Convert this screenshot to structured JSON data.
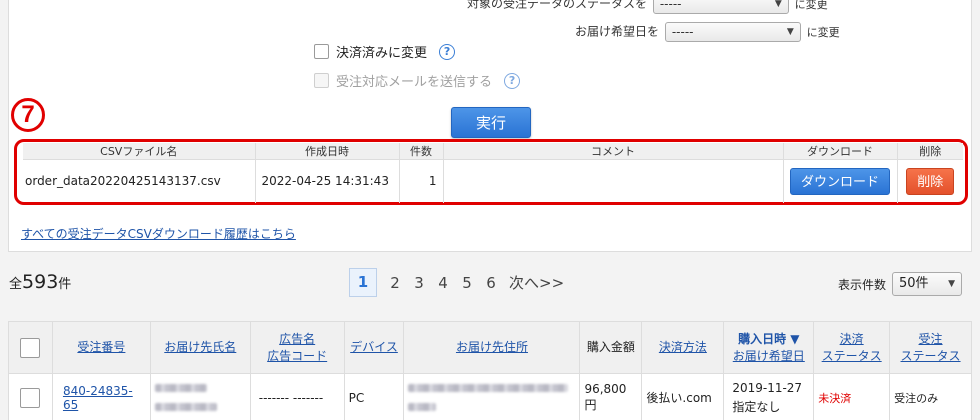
{
  "form": {
    "status_label": "対象の受注データのステータスを",
    "status_value": "-----",
    "status_suffix": "に変更",
    "date_label": "お届け希望日を",
    "date_value": "-----",
    "date_suffix": "に変更",
    "settled_label": "決済済みに変更",
    "mail_label": "受注対応メールを送信する",
    "help_glyph": "?",
    "step_number": "7",
    "execute_label": "実行"
  },
  "csv_table": {
    "headers": [
      "CSVファイル名",
      "作成日時",
      "件数",
      "コメント",
      "ダウンロード",
      "削除"
    ],
    "row": {
      "filename": "order_data20220425143137.csv",
      "created": "2022-04-25 14:31:43",
      "count": "1",
      "comment": "",
      "download_label": "ダウンロード",
      "delete_label": "削除"
    }
  },
  "history_link": "すべての受注データCSVダウンロード履歴はこちら",
  "summary": {
    "prefix": "全",
    "count": "593",
    "suffix": "件"
  },
  "pagination": {
    "pages": [
      "1",
      "2",
      "3",
      "4",
      "5",
      "6"
    ],
    "current": "1",
    "next_label": "次へ>>"
  },
  "per_page": {
    "label": "表示件数",
    "value": "50件"
  },
  "orders": {
    "headers": {
      "order_no": "受注番号",
      "recipient": "お届け先氏名",
      "ad_name": "広告名",
      "ad_code": "広告コード",
      "device": "デバイス",
      "address": "お届け先住所",
      "amount": "購入金額",
      "payment": "決済方法",
      "purchased": "購入日時 ▼",
      "delivery_date": "お届け希望日",
      "settle1": "決済",
      "settle2": "ステータス",
      "order1": "受注",
      "order2": "ステータス"
    },
    "row": {
      "order_no": "840-24835-65",
      "ad": "------- -------",
      "device": "PC",
      "amount": "96,800円",
      "payment": "後払い.com",
      "date": "2019-11-27",
      "delivery": "指定なし",
      "settle_status": "未決済",
      "order_status": "受注のみ"
    }
  },
  "colors": {
    "accent": "#2a73d4",
    "danger": "#e4512b",
    "highlight": "#e00000"
  }
}
